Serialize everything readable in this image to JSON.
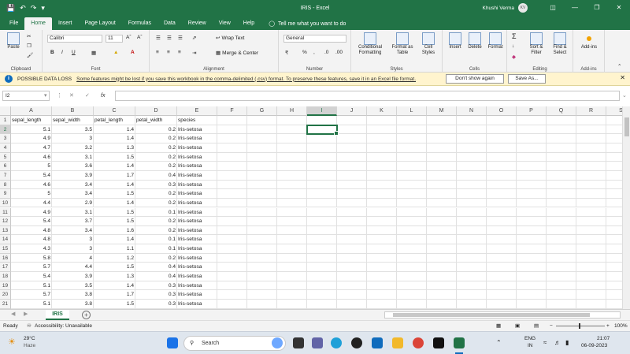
{
  "window": {
    "title": "IRIS  -  Excel",
    "user_name": "Khushi Verma",
    "user_initials": "KV"
  },
  "menu": {
    "tabs": [
      "File",
      "Home",
      "Insert",
      "Page Layout",
      "Formulas",
      "Data",
      "Review",
      "View",
      "Help"
    ],
    "active_tab": "Home",
    "tell_me": "Tell me what you want to do"
  },
  "ribbon": {
    "clipboard": {
      "paste": "Paste",
      "label": "Clipboard"
    },
    "font": {
      "name": "Calibri",
      "size": "11",
      "label": "Font"
    },
    "alignment": {
      "wrap_text": "Wrap Text",
      "merge_center": "Merge & Center",
      "label": "Alignment"
    },
    "number": {
      "format": "General",
      "label": "Number"
    },
    "styles": {
      "conditional": "Conditional Formatting",
      "format_table": "Format as Table",
      "cell_styles": "Cell Styles",
      "label": "Styles"
    },
    "cells": {
      "insert": "Insert",
      "delete": "Delete",
      "format": "Format",
      "label": "Cells"
    },
    "editing": {
      "sort_filter": "Sort & Filter",
      "find_select": "Find & Select",
      "label": "Editing"
    },
    "addins": {
      "button": "Add-ins",
      "label": "Add-ins"
    }
  },
  "message_bar": {
    "title": "POSSIBLE DATA LOSS",
    "text": "Some features might be lost if you save this workbook in the comma-delimited (.csv) format. To preserve these features, save it in an Excel file format.",
    "dont_show": "Don't show again",
    "save_as": "Save As..."
  },
  "formula_bar": {
    "name_box": "I2",
    "fx": "fx",
    "value": ""
  },
  "grid": {
    "columns": [
      "A",
      "B",
      "C",
      "D",
      "E",
      "F",
      "G",
      "H",
      "I",
      "J",
      "K",
      "L",
      "M",
      "N",
      "O",
      "P",
      "Q",
      "R",
      "S"
    ],
    "selected_column": "I",
    "selected_row": 2,
    "header_row": [
      "sepal_length",
      "sepal_width",
      "petal_length",
      "petal_width",
      "species"
    ],
    "rows": [
      [
        "5.1",
        "3.5",
        "1.4",
        "0.2",
        "Iris-setosa"
      ],
      [
        "4.9",
        "3",
        "1.4",
        "0.2",
        "Iris-setosa"
      ],
      [
        "4.7",
        "3.2",
        "1.3",
        "0.2",
        "Iris-setosa"
      ],
      [
        "4.6",
        "3.1",
        "1.5",
        "0.2",
        "Iris-setosa"
      ],
      [
        "5",
        "3.6",
        "1.4",
        "0.2",
        "Iris-setosa"
      ],
      [
        "5.4",
        "3.9",
        "1.7",
        "0.4",
        "Iris-setosa"
      ],
      [
        "4.6",
        "3.4",
        "1.4",
        "0.3",
        "Iris-setosa"
      ],
      [
        "5",
        "3.4",
        "1.5",
        "0.2",
        "Iris-setosa"
      ],
      [
        "4.4",
        "2.9",
        "1.4",
        "0.2",
        "Iris-setosa"
      ],
      [
        "4.9",
        "3.1",
        "1.5",
        "0.1",
        "Iris-setosa"
      ],
      [
        "5.4",
        "3.7",
        "1.5",
        "0.2",
        "Iris-setosa"
      ],
      [
        "4.8",
        "3.4",
        "1.6",
        "0.2",
        "Iris-setosa"
      ],
      [
        "4.8",
        "3",
        "1.4",
        "0.1",
        "Iris-setosa"
      ],
      [
        "4.3",
        "3",
        "1.1",
        "0.1",
        "Iris-setosa"
      ],
      [
        "5.8",
        "4",
        "1.2",
        "0.2",
        "Iris-setosa"
      ],
      [
        "5.7",
        "4.4",
        "1.5",
        "0.4",
        "Iris-setosa"
      ],
      [
        "5.4",
        "3.9",
        "1.3",
        "0.4",
        "Iris-setosa"
      ],
      [
        "5.1",
        "3.5",
        "1.4",
        "0.3",
        "Iris-setosa"
      ],
      [
        "5.7",
        "3.8",
        "1.7",
        "0.3",
        "Iris-setosa"
      ],
      [
        "5.1",
        "3.8",
        "1.5",
        "0.3",
        "Iris-setosa"
      ]
    ]
  },
  "sheets": {
    "active": "IRIS"
  },
  "status": {
    "ready": "Ready",
    "accessibility": "Accessibility: Unavailable",
    "zoom": "100%"
  },
  "taskbar": {
    "weather_temp": "29°C",
    "weather_desc": "Haze",
    "search": "Search",
    "language_1": "ENG",
    "language_2": "IN",
    "time": "21:07",
    "date": "06-09-2023"
  },
  "colors": {
    "excel_green": "#217346",
    "message_bar": "#fff4ce",
    "info_blue": "#0f6cbd"
  }
}
